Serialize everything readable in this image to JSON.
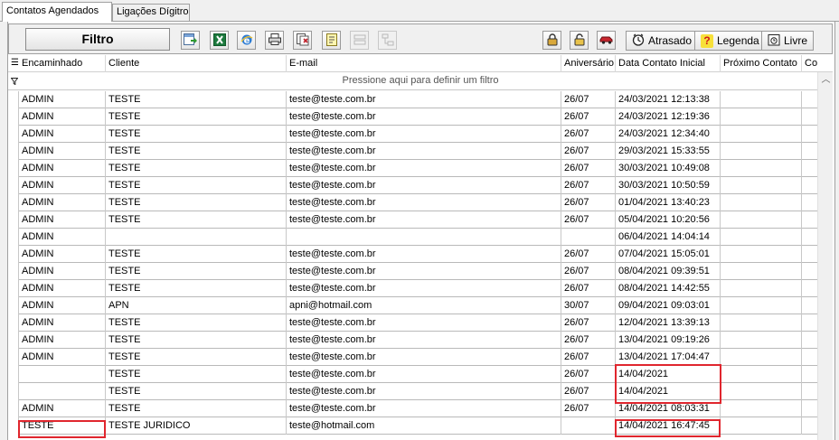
{
  "tabs": [
    {
      "label": "Contatos Agendados",
      "active": true
    },
    {
      "label": "Ligações Dígitro",
      "active": false
    }
  ],
  "toolbar": {
    "filtro_label": "Filtro",
    "atrasado_label": "Atrasado",
    "legenda_label": "Legenda",
    "livre_label": "Livre"
  },
  "grid": {
    "columns": [
      "Encaminhado",
      "Cliente",
      "E-mail",
      "Aniversário",
      "Data Contato Inicial",
      "Próximo Contato",
      "Co"
    ],
    "filter_hint": "Pressione aqui para definir um filtro",
    "rows": [
      [
        "ADMIN",
        "TESTE",
        "teste@teste.com.br",
        "26/07",
        "24/03/2021 12:13:38",
        "",
        ""
      ],
      [
        "ADMIN",
        "TESTE",
        "teste@teste.com.br",
        "26/07",
        "24/03/2021 12:19:36",
        "",
        ""
      ],
      [
        "ADMIN",
        "TESTE",
        "teste@teste.com.br",
        "26/07",
        "24/03/2021 12:34:40",
        "",
        ""
      ],
      [
        "ADMIN",
        "TESTE",
        "teste@teste.com.br",
        "26/07",
        "29/03/2021 15:33:55",
        "",
        ""
      ],
      [
        "ADMIN",
        "TESTE",
        "teste@teste.com.br",
        "26/07",
        "30/03/2021 10:49:08",
        "",
        ""
      ],
      [
        "ADMIN",
        "TESTE",
        "teste@teste.com.br",
        "26/07",
        "30/03/2021 10:50:59",
        "",
        ""
      ],
      [
        "ADMIN",
        "TESTE",
        "teste@teste.com.br",
        "26/07",
        "01/04/2021 13:40:23",
        "",
        ""
      ],
      [
        "ADMIN",
        "TESTE",
        "teste@teste.com.br",
        "26/07",
        "05/04/2021 10:20:56",
        "",
        ""
      ],
      [
        "ADMIN",
        "",
        "",
        "",
        "06/04/2021 14:04:14",
        "",
        ""
      ],
      [
        "ADMIN",
        "TESTE",
        "teste@teste.com.br",
        "26/07",
        "07/04/2021 15:05:01",
        "",
        ""
      ],
      [
        "ADMIN",
        "TESTE",
        "teste@teste.com.br",
        "26/07",
        "08/04/2021 09:39:51",
        "",
        ""
      ],
      [
        "ADMIN",
        "TESTE",
        "teste@teste.com.br",
        "26/07",
        "08/04/2021 14:42:55",
        "",
        ""
      ],
      [
        "ADMIN",
        "APN",
        "apni@hotmail.com",
        "30/07",
        "09/04/2021 09:03:01",
        "",
        ""
      ],
      [
        "ADMIN",
        "TESTE",
        "teste@teste.com.br",
        "26/07",
        "12/04/2021 13:39:13",
        "",
        ""
      ],
      [
        "ADMIN",
        "TESTE",
        "teste@teste.com.br",
        "26/07",
        "13/04/2021 09:19:26",
        "",
        ""
      ],
      [
        "ADMIN",
        "TESTE",
        "teste@teste.com.br",
        "26/07",
        "13/04/2021 17:04:47",
        "",
        ""
      ],
      [
        "",
        "TESTE",
        "teste@teste.com.br",
        "26/07",
        "14/04/2021",
        "",
        ""
      ],
      [
        "",
        "TESTE",
        "teste@teste.com.br",
        "26/07",
        "14/04/2021",
        "",
        ""
      ],
      [
        "ADMIN",
        "TESTE",
        "teste@teste.com.br",
        "26/07",
        "14/04/2021 08:03:31",
        "",
        ""
      ],
      [
        "TESTE",
        "TESTE JURIDICO",
        "teste@hotmail.com",
        "",
        "14/04/2021 16:47:45",
        "",
        ""
      ]
    ]
  },
  "colors": {
    "highlight": "#e0262e"
  }
}
